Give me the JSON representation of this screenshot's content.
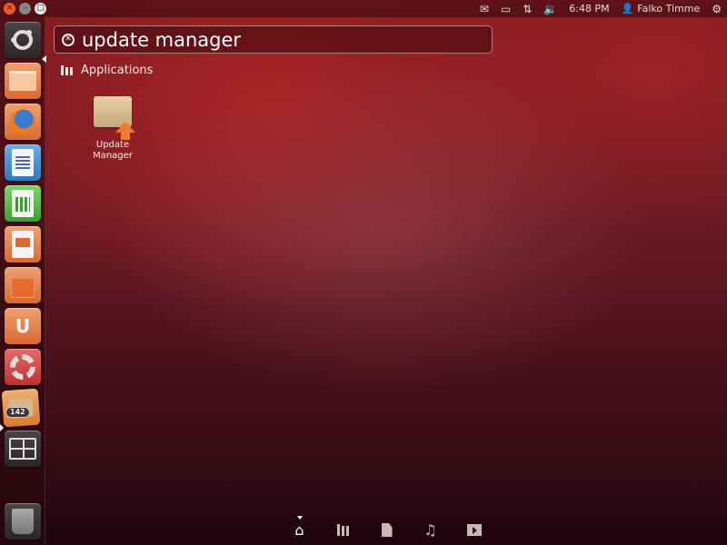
{
  "window_controls": {
    "close": "×",
    "minimize": "–",
    "maximize": "□"
  },
  "panel": {
    "indicators": [
      {
        "name": "messaging-icon",
        "glyph": "✉"
      },
      {
        "name": "battery-icon",
        "glyph": "▭"
      },
      {
        "name": "network-icon",
        "glyph": "⇅"
      },
      {
        "name": "volume-icon",
        "glyph": "🔉"
      }
    ],
    "clock": "6:48 PM",
    "user_icon": "👤",
    "user_name": "Falko Timme",
    "session_icon": "⚙"
  },
  "launcher": {
    "items": [
      {
        "name": "Dash Home"
      },
      {
        "name": "Home Folder"
      },
      {
        "name": "Firefox Web Browser"
      },
      {
        "name": "LibreOffice Writer"
      },
      {
        "name": "LibreOffice Calc"
      },
      {
        "name": "LibreOffice Impress"
      },
      {
        "name": "Ubuntu Software Center"
      },
      {
        "name": "Ubuntu One"
      },
      {
        "name": "System Settings"
      },
      {
        "name": "Update Manager",
        "badge": "142"
      },
      {
        "name": "Workspace Switcher"
      },
      {
        "name": "Trash"
      }
    ],
    "ubuntu_one_glyph": "U"
  },
  "search": {
    "value": "update manager",
    "clear_glyph": "✕"
  },
  "category": {
    "label": "Applications"
  },
  "results": [
    {
      "label": "Update Manager"
    }
  ],
  "lenses": [
    {
      "name": "home",
      "glyph": "⌂",
      "active": true
    },
    {
      "name": "applications"
    },
    {
      "name": "files"
    },
    {
      "name": "music",
      "glyph": "♫"
    },
    {
      "name": "video"
    }
  ]
}
